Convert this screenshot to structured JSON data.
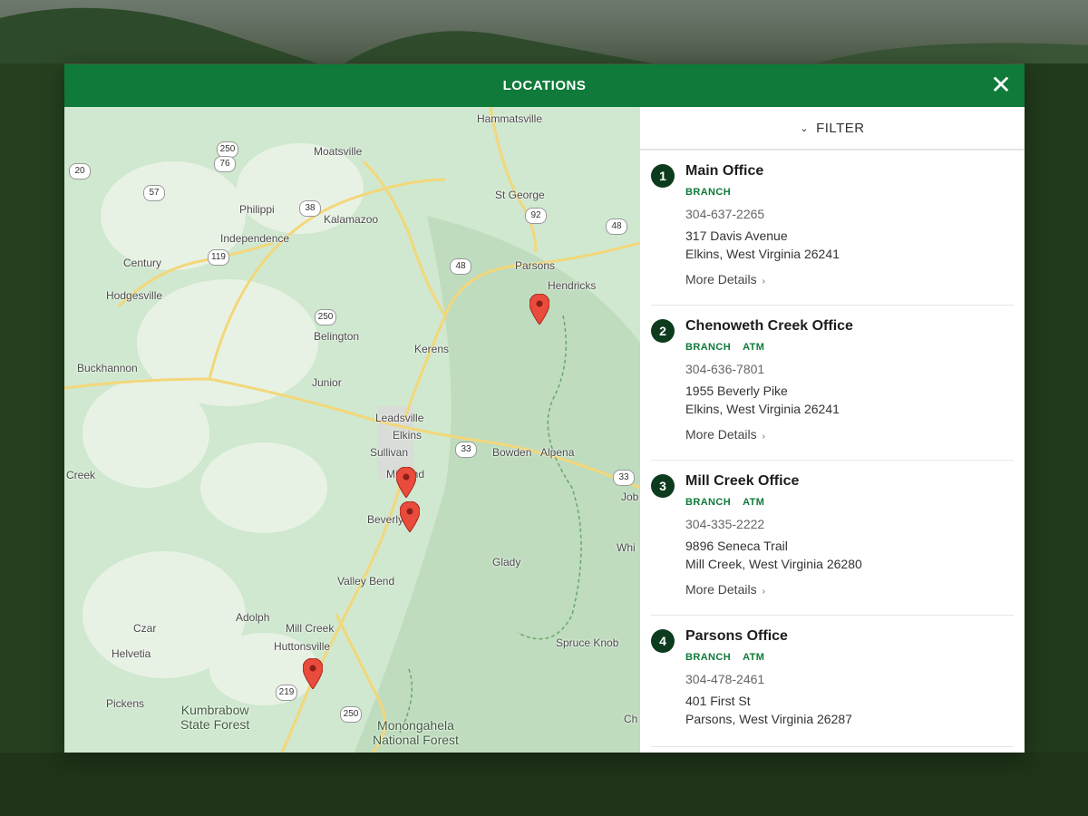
{
  "modal": {
    "title": "LOCATIONS",
    "close_icon": "close-icon"
  },
  "filter": {
    "label": "FILTER",
    "icon": "chevron-down-icon"
  },
  "map": {
    "places": [
      "Hammatsville",
      "Moatsville",
      "Philippi",
      "Kalamazoo",
      "Independence",
      "St George",
      "Parsons",
      "Hendricks",
      "Century",
      "Hodgesville",
      "Belington",
      "Kerens",
      "Buckhannon",
      "Junior",
      "Leadsville",
      "Elkins",
      "Sullivan",
      "Midland",
      "Bowden",
      "Alpena",
      "Beverly",
      "Valley Bend",
      "Glady",
      "Adolph",
      "Mill Creek",
      "Czar",
      "Helvetia",
      "Huttonsville",
      "Pickens",
      "Spruce Knob",
      "Creek",
      "Job",
      "Whi",
      "Ch"
    ],
    "areas": [
      "Kumbrabow\nState Forest",
      "Monongahela\nNational Forest"
    ],
    "routes": [
      "250",
      "76",
      "57",
      "20",
      "38",
      "92",
      "48",
      "119",
      "250",
      "48",
      "33",
      "33",
      "219",
      "250"
    ]
  },
  "locations": [
    {
      "number": "1",
      "name": "Main Office",
      "tags": [
        "BRANCH"
      ],
      "phone": "304-637-2265",
      "address1": "317 Davis Avenue",
      "address2": "Elkins, West Virginia 26241",
      "more": "More Details"
    },
    {
      "number": "2",
      "name": "Chenoweth Creek Office",
      "tags": [
        "BRANCH",
        "ATM"
      ],
      "phone": "304-636-7801",
      "address1": "1955 Beverly Pike",
      "address2": "Elkins, West Virginia 26241",
      "more": "More Details"
    },
    {
      "number": "3",
      "name": "Mill Creek Office",
      "tags": [
        "BRANCH",
        "ATM"
      ],
      "phone": "304-335-2222",
      "address1": "9896 Seneca Trail",
      "address2": "Mill Creek, West Virginia 26280",
      "more": "More Details"
    },
    {
      "number": "4",
      "name": "Parsons Office",
      "tags": [
        "BRANCH",
        "ATM"
      ],
      "phone": "304-478-2461",
      "address1": "401 First St",
      "address2": "Parsons, West Virginia 26287",
      "more": "More Details"
    }
  ],
  "colors": {
    "header": "#0f7a3a",
    "badge": "#0d3b1e",
    "tag": "#0f7a3a",
    "map_pin": "#e94b3c"
  }
}
